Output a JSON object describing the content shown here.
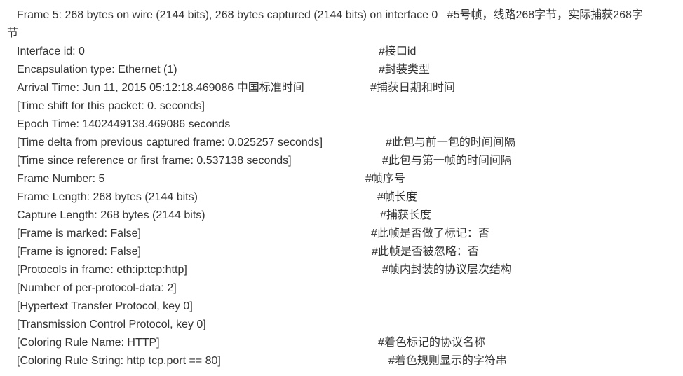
{
  "header": {
    "code": "Frame 5: 268 bytes on wire (2144 bits), 268 bytes captured (2144 bits) on interface 0",
    "comment_main": "#5号帧，线路268字节，实际捕获268字",
    "comment_tail": "节"
  },
  "lines": [
    {
      "code": "Interface id: 0",
      "comment": "#接口id"
    },
    {
      "code": "Encapsulation type: Ethernet (1)",
      "comment": "#封装类型"
    },
    {
      "code": "Arrival Time: Jun 11, 2015 05:12:18.469086 中国标准时间",
      "comment": "#捕获日期和时间"
    },
    {
      "code": "[Time shift for this packet: 0. seconds]",
      "comment": ""
    },
    {
      "code": "Epoch Time: 1402449138.469086 seconds",
      "comment": ""
    },
    {
      "code": "[Time delta from previous captured frame: 0.025257 seconds]",
      "comment": "#此包与前一包的时间间隔"
    },
    {
      "code": "[Time since reference or first frame: 0.537138 seconds]",
      "comment": "#此包与第一帧的时间间隔"
    },
    {
      "code": "Frame Number: 5",
      "comment": "#帧序号"
    },
    {
      "code": "Frame Length: 268 bytes (2144 bits)",
      "comment": "#帧长度"
    },
    {
      "code": "Capture Length: 268 bytes (2144 bits)",
      "comment": "#捕获长度"
    },
    {
      "code": "[Frame is marked: False]",
      "comment": "#此帧是否做了标记：否"
    },
    {
      "code": "[Frame is ignored: False]",
      "comment": "#此帧是否被忽略：否"
    },
    {
      "code": "[Protocols in frame: eth:ip:tcp:http]",
      "comment": "#帧内封装的协议层次结构"
    },
    {
      "code": "[Number of per-protocol-data: 2]",
      "comment": ""
    },
    {
      "code": "[Hypertext Transfer Protocol, key 0]",
      "comment": ""
    },
    {
      "code": "[Transmission Control Protocol, key 0]",
      "comment": ""
    },
    {
      "code": "[Coloring Rule Name: HTTP]",
      "comment": "#着色标记的协议名称"
    },
    {
      "code": "[Coloring Rule String: http tcp.port == 80]",
      "comment": "#着色规则显示的字符串"
    }
  ]
}
